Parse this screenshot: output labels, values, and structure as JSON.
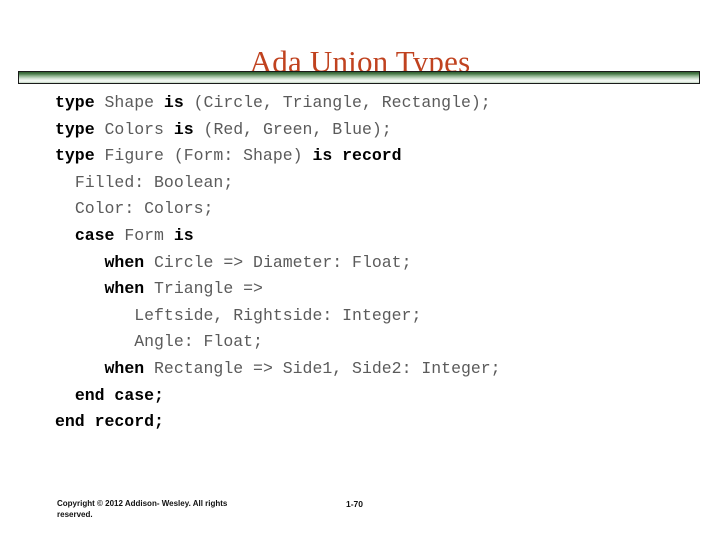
{
  "slide": {
    "title": "Ada Union Types",
    "title_color": "#C0421F",
    "divider_color_dark": "#2f5c2f",
    "divider_color_light": "#f3f8f3",
    "keyword_color": "#000000",
    "identifier_color": "#5b5b5b",
    "background_color": "#ffffff"
  },
  "code": {
    "lines": [
      {
        "id": "line-1",
        "indent": 0,
        "tokens": [
          {
            "t": "type",
            "kw": true
          },
          {
            "t": " Shape ",
            "kw": false
          },
          {
            "t": "is",
            "kw": true
          },
          {
            "t": " (Circle, Triangle, Rectangle);",
            "kw": false
          }
        ]
      },
      {
        "id": "line-2",
        "indent": 0,
        "tokens": [
          {
            "t": "type",
            "kw": true
          },
          {
            "t": " Colors ",
            "kw": false
          },
          {
            "t": "is",
            "kw": true
          },
          {
            "t": " (Red, Green, Blue);",
            "kw": false
          }
        ]
      },
      {
        "id": "line-3",
        "indent": 0,
        "tokens": [
          {
            "t": "type",
            "kw": true
          },
          {
            "t": " Figure (Form: Shape) ",
            "kw": false
          },
          {
            "t": "is record",
            "kw": true
          }
        ]
      },
      {
        "id": "line-4",
        "indent": 2,
        "tokens": [
          {
            "t": "Filled: Boolean;",
            "kw": false
          }
        ]
      },
      {
        "id": "line-5",
        "indent": 2,
        "tokens": [
          {
            "t": "Color: Colors;",
            "kw": false
          }
        ]
      },
      {
        "id": "line-6",
        "indent": 2,
        "tokens": [
          {
            "t": "case",
            "kw": true
          },
          {
            "t": " Form ",
            "kw": false
          },
          {
            "t": "is",
            "kw": true
          }
        ]
      },
      {
        "id": "line-7",
        "indent": 5,
        "tokens": [
          {
            "t": "when",
            "kw": true
          },
          {
            "t": " Circle => Diameter: Float;",
            "kw": false
          }
        ]
      },
      {
        "id": "line-8",
        "indent": 5,
        "tokens": [
          {
            "t": "when",
            "kw": true
          },
          {
            "t": " Triangle =>",
            "kw": false
          }
        ]
      },
      {
        "id": "line-9",
        "indent": 8,
        "tokens": [
          {
            "t": "Leftside, Rightside: Integer;",
            "kw": false
          }
        ]
      },
      {
        "id": "line-10",
        "indent": 8,
        "tokens": [
          {
            "t": "Angle: Float;",
            "kw": false
          }
        ]
      },
      {
        "id": "line-11",
        "indent": 5,
        "tokens": [
          {
            "t": "when",
            "kw": true
          },
          {
            "t": " Rectangle => Side1, Side2: Integer;",
            "kw": false
          }
        ]
      },
      {
        "id": "line-12",
        "indent": 2,
        "tokens": [
          {
            "t": "end case;",
            "kw": true
          }
        ]
      },
      {
        "id": "line-13",
        "indent": 0,
        "tokens": [
          {
            "t": "end record;",
            "kw": true
          }
        ]
      }
    ]
  },
  "footer": {
    "copyright_line1": "Copyright © 2012 Addison-",
    "copyright_line2": "Wesley. All rights reserved.",
    "page_number": "1-70"
  }
}
